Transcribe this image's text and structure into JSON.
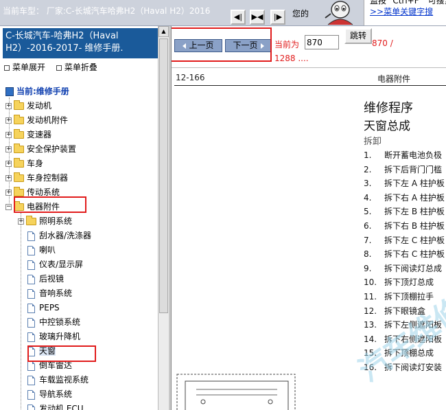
{
  "topbar": {
    "car_line": "当前车型：  厂家:C-长城汽车哈弗H2（Haval H2）2016",
    "nav_buttons": [
      "◀|",
      "▶◀",
      "|▶"
    ],
    "your_text": "您的",
    "hint_line1": "监按 \"Ctrl+F \" 可搜索",
    "hint_line2": ">>菜单关键字搜"
  },
  "left": {
    "manual_title": "C-长城汽车-哈弗H2（Haval H2）-2016-2017- 维修手册.",
    "expand_label": "菜单展开",
    "collapse_label": "菜单折叠",
    "current": "当前:维修手册",
    "folders": [
      "发动机",
      "发动机附件",
      "变速器",
      "安全保护装置",
      "车身",
      "车身控制器",
      "传动系统",
      "电器附件"
    ],
    "subfolder": "照明系统",
    "items": [
      "刮水器/洗涤器",
      "喇叭",
      "仪表/显示屏",
      "后视镜",
      "音响系统",
      "PEPS",
      "中控锁系统",
      "玻璃升降机",
      "天窗",
      "倒车雷达",
      "车载监视系统",
      "导航系统",
      "发动机 ECU"
    ]
  },
  "pager": {
    "prev_label": "上一页",
    "next_label": "下一页",
    "current_label": "当前为",
    "current_page": "870",
    "go_label": "跳转",
    "total_label": "870 /",
    "total_pages": "1288 ...."
  },
  "doc": {
    "page_number": "12-166",
    "category": "电器附件",
    "procedure": "维修程序",
    "assembly": "天窗总成",
    "remove": "拆卸",
    "steps": [
      {
        "n": "1.",
        "t": "断开蓄电池负极"
      },
      {
        "n": "2.",
        "t": "拆下后背门门槛"
      },
      {
        "n": "3.",
        "t": "拆下左 A 柱护板"
      },
      {
        "n": "4.",
        "t": "拆下右 A 柱护板"
      },
      {
        "n": "5.",
        "t": "拆下左 B 柱护板"
      },
      {
        "n": "6.",
        "t": "拆下右 B 柱护板"
      },
      {
        "n": "7.",
        "t": "拆下左 C 柱护板"
      },
      {
        "n": "8.",
        "t": "拆下右 C 柱护板"
      },
      {
        "n": "9.",
        "t": "拆下阅读灯总成"
      },
      {
        "n": "10.",
        "t": "拆下顶灯总成"
      },
      {
        "n": "11.",
        "t": "拆下顶棚拉手"
      },
      {
        "n": "12.",
        "t": "拆下眼镜盒"
      },
      {
        "n": "13.",
        "t": "拆下左侧遮阳板"
      },
      {
        "n": "14.",
        "t": "拆下右侧遮阳板"
      },
      {
        "n": "15.",
        "t": "拆下顶棚总成"
      },
      {
        "n": "16.",
        "t": "拆下阅读灯安装"
      }
    ],
    "watermark": "汽车维修"
  },
  "colors": {
    "title_bg": "#1a5a9a",
    "highlight_red": "#e11b1b",
    "button_blue": "#8aa1c7"
  }
}
